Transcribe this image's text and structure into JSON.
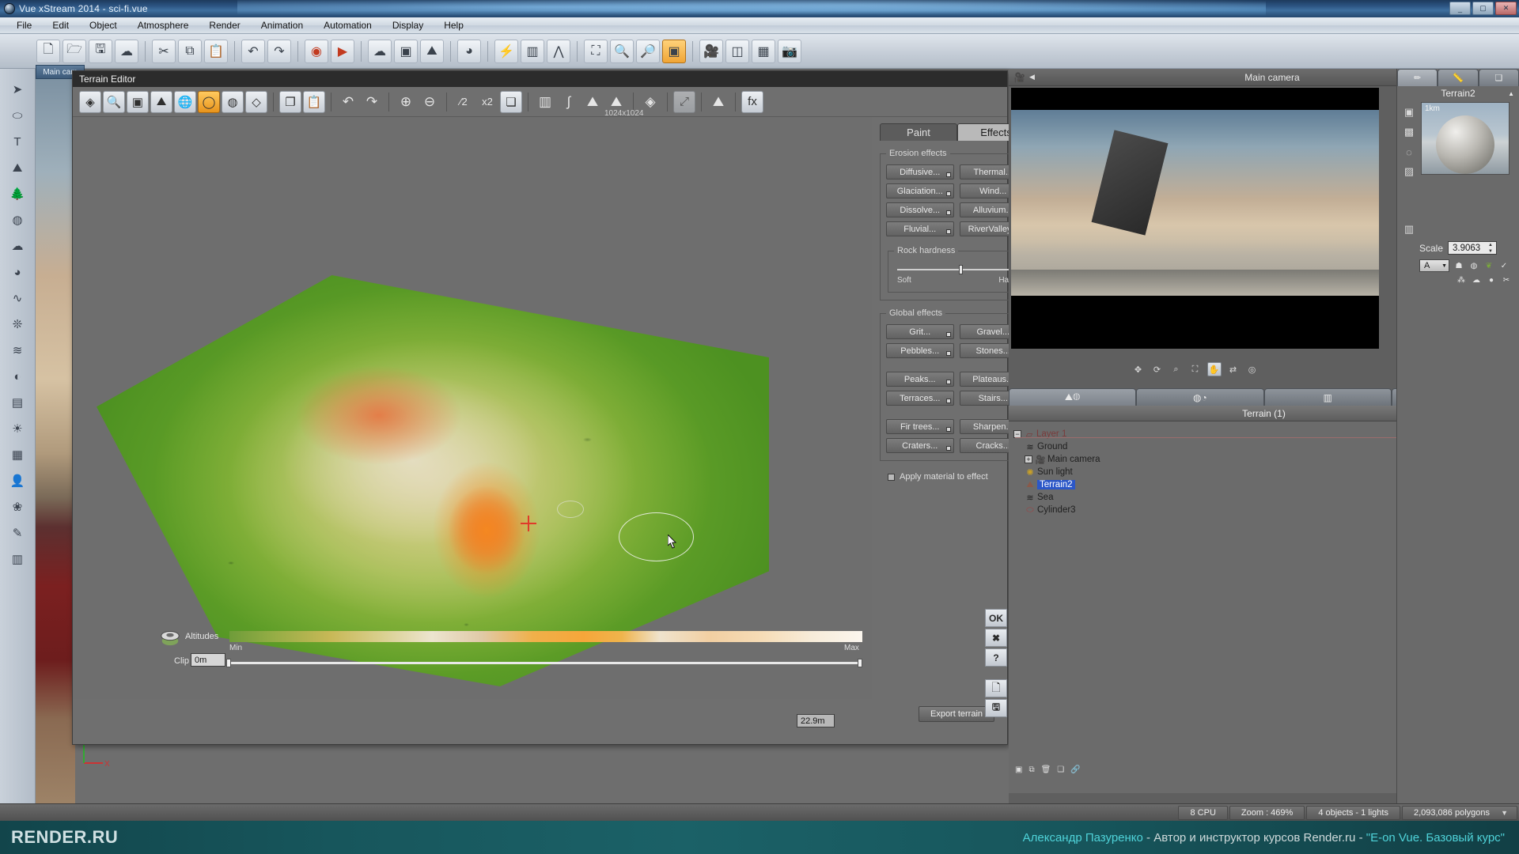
{
  "window": {
    "title": "Vue xStream 2014 - sci-fi.vue",
    "app_icon": "sphere-app-icon",
    "buttons": {
      "minimize": "_",
      "maximize": "▢",
      "close": "✕"
    }
  },
  "menubar": {
    "items": [
      "File",
      "Edit",
      "Object",
      "Atmosphere",
      "Render",
      "Animation",
      "Automation",
      "Display",
      "Help"
    ]
  },
  "toolbar": {
    "icons": [
      "new-document-icon",
      "open-folder-icon",
      "save-disk-icon",
      "cloud-icon",
      "cut-scissors-icon",
      "copy-icon",
      "paste-icon",
      "undo-arrow-icon",
      "redo-arrow-icon",
      "render-preview-icon",
      "render-play-icon",
      "atmosphere-cloud-icon",
      "cube-icon",
      "terrain-mountain-icon",
      "material-sphere-icon",
      "chart-bars-icon",
      "lightning-icon",
      "zoom-region-icon",
      "zoom-in-icon",
      "zoom-out-icon",
      "fit-view-icon",
      "camera-icon",
      "motion-icon",
      "layout-icon",
      "snapshot-icon"
    ]
  },
  "left_tool_strip": {
    "icons": [
      "select-arrow-icon",
      "cylinder-primitive-icon",
      "text-icon",
      "mountain-icon",
      "tree-icon",
      "sphere-icon",
      "cloud-icon",
      "rock-icon",
      "wave-icon",
      "water-icon",
      "boolean-icon",
      "metablob-icon",
      "layers-icon",
      "light-icon",
      "grid-icon",
      "ellipsoid-icon",
      "plant-icon",
      "pen-icon",
      "box-icon"
    ]
  },
  "viewport_tab": {
    "label": "Main cam"
  },
  "terrain_editor": {
    "title": "Terrain Editor",
    "resolution": "1024x1024",
    "toolbar_icons": [
      "terrain-select-icon",
      "inspect-magnifier-icon",
      "heightfield-icon",
      "rocks-icon",
      "globe-icon",
      "sphere-selected-icon",
      "rough-sphere-icon",
      "flat-terrain-icon",
      "copy-pages-icon",
      "paste-clipboard-icon",
      "undo-arrow-icon",
      "redo-arrow-icon",
      "zoom-in-icon",
      "zoom-out-icon",
      "half-resolution-icon",
      "double-resolution-icon",
      "resize-icon",
      "histogram-icon",
      "curve-icon",
      "terrain-filter-gear-icon",
      "terrain-add-gear-icon",
      "smooth-terrain-icon",
      "mirror-icon",
      "terrain-2d-icon",
      "checker-fx-icon"
    ],
    "divider_labels": {
      "half": "⁄2",
      "double": "x2"
    },
    "tabs": [
      {
        "label": "Paint",
        "active": false
      },
      {
        "label": "Effects",
        "active": true
      }
    ],
    "erosion_effects": {
      "legend": "Erosion effects",
      "buttons": [
        "Diffusive...",
        "Thermal...",
        "Glaciation...",
        "Wind...",
        "Dissolve...",
        "Alluvium...",
        "Fluvial...",
        "RiverValley..."
      ]
    },
    "rock_hardness": {
      "legend": "Rock hardness",
      "min_label": "Soft",
      "max_label": "Hard",
      "value_percent": 52
    },
    "global_effects": {
      "legend": "Global effects",
      "buttons": [
        "Grit...",
        "Gravel...",
        "Pebbles...",
        "Stones...",
        "Peaks...",
        "Plateaus...",
        "Terraces...",
        "Stairs...",
        "Fir trees...",
        "Sharpen...",
        "Craters...",
        "Cracks..."
      ]
    },
    "apply_material": {
      "label": "Apply material to effect",
      "checked": true
    },
    "export_button": "Export terrain",
    "altitudes": {
      "label": "Altitudes",
      "icon": "altitude-layers-icon",
      "min_label": "Min",
      "max_label": "Max"
    },
    "clip": {
      "label": "Clip",
      "min_value": "0m",
      "max_value": "22.9m"
    },
    "action_buttons": [
      {
        "name": "ok-button",
        "label": "OK"
      },
      {
        "name": "cancel-button",
        "label": "✖"
      },
      {
        "name": "help-button",
        "label": "?"
      },
      {
        "name": "new-preset-button",
        "label": "🗋"
      },
      {
        "name": "save-preset-button",
        "label": "🖫"
      }
    ]
  },
  "camera_panel": {
    "title": "Main camera",
    "camera_icon": "camera-icon",
    "prev_arrow": "◀",
    "next_arrow": "▶",
    "collapse_arrow": "▲",
    "tool_icons": [
      "pan-icon",
      "rotate-icon",
      "zoom-icon",
      "fit-icon",
      "move-icon",
      "banking-icon",
      "hand-tool-icon",
      "flip-icon",
      "target-icon"
    ]
  },
  "object_browser": {
    "tabs": [
      {
        "icon": "world-browser-icon",
        "active": true
      },
      {
        "icon": "materials-icon",
        "active": false
      },
      {
        "icon": "library-icon",
        "active": false
      },
      {
        "icon": "links-icon",
        "active": false
      }
    ],
    "title": "Terrain (1)",
    "tree": [
      {
        "label": "Layer 1",
        "icon": "layer-icon",
        "level": 0,
        "expander": "−",
        "selected": false,
        "is_layer": true
      },
      {
        "label": "Ground",
        "icon": "ground-icon",
        "level": 1,
        "expander": "",
        "selected": false
      },
      {
        "label": "Main camera",
        "icon": "camera-icon",
        "level": 1,
        "expander": "+",
        "selected": false
      },
      {
        "label": "Sun light",
        "icon": "sun-icon",
        "level": 1,
        "expander": "",
        "selected": false
      },
      {
        "label": "Terrain2",
        "icon": "terrain-icon",
        "level": 1,
        "expander": "",
        "selected": true
      },
      {
        "label": "Sea",
        "icon": "water-icon",
        "level": 1,
        "expander": "",
        "selected": false
      },
      {
        "label": "Cylinder3",
        "icon": "cylinder-icon",
        "level": 1,
        "expander": "",
        "selected": false
      }
    ],
    "bottom_icons": [
      "new-layer-icon",
      "duplicate-icon",
      "delete-icon",
      "group-icon",
      "link-icon"
    ]
  },
  "properties_panel": {
    "tabs": [
      {
        "icon": "pencil-icon",
        "active": true
      },
      {
        "icon": "ruler-icon",
        "active": false
      },
      {
        "icon": "copies-icon",
        "active": false
      }
    ],
    "object_name": "Terrain2",
    "collapse_arrow": "▲",
    "preview_scale_label": "1km",
    "scale": {
      "label": "Scale",
      "value": "3.9063"
    },
    "layer_select": "A",
    "side_icons": [
      "cube-material-icon",
      "checker-material-icon",
      "color-dots-icon",
      "checker-arrow-icon",
      "box-icon"
    ],
    "effect_icons": [
      "ghost-icon",
      "sphere-icon",
      "plant-icon",
      "check-icon",
      "person-icon",
      "cloud-icon",
      "ball-icon",
      "tool-icon"
    ]
  },
  "statusbar": {
    "items": [
      "8 CPU",
      "Zoom : 469%",
      "4 objects - 1 lights",
      "2,093,086 polygons"
    ],
    "dropdown_arrow": "▼"
  },
  "banner": {
    "logo": "RENDER.RU",
    "author": "Александр Пазуренко",
    "separator1": " - ",
    "role": "Автор и инструктор курсов Render.ru",
    "separator2": " - ",
    "course": "\"E-on Vue. Базовый курс\""
  },
  "colors": {
    "titlebar_blue": "#2d5583",
    "accent_orange": "#f0a535",
    "selection_blue": "#2b57c8",
    "banner_teal": "#17565c",
    "banner_highlight": "#4fd3d9",
    "layer_red": "#7a3b3b"
  }
}
